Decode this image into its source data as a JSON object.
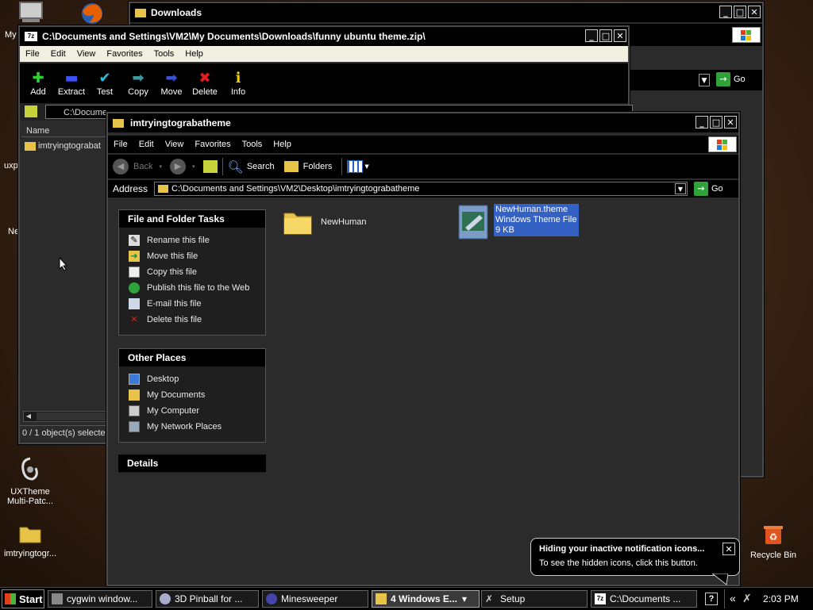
{
  "desktop": {
    "icons": {
      "my_computer": "My",
      "uxp": "uxp",
      "ne": "Ne",
      "uxtheme": "UXTheme Multi-Patc...",
      "folder": "imtryingtogr...",
      "recycle": "Recycle Bin"
    }
  },
  "downloads_window": {
    "title": "Downloads",
    "go_label": "Go"
  },
  "zip_window": {
    "title": "C:\\Documents and Settings\\VM2\\My Documents\\Downloads\\funny ubuntu theme.zip\\",
    "menu": [
      "File",
      "Edit",
      "View",
      "Favorites",
      "Tools",
      "Help"
    ],
    "toolbar": [
      "Add",
      "Extract",
      "Test",
      "Copy",
      "Move",
      "Delete",
      "Info"
    ],
    "path": "C:\\Docume",
    "column_name": "Name",
    "item": "imtryingtograbat",
    "status": "0 / 1 object(s) selecte"
  },
  "explorer": {
    "title": "imtryingtograbatheme",
    "menu": [
      "File",
      "Edit",
      "View",
      "Favorites",
      "Tools",
      "Help"
    ],
    "back_label": "Back",
    "search_label": "Search",
    "folders_label": "Folders",
    "address_label": "Address",
    "address_value": "C:\\Documents and Settings\\VM2\\Desktop\\imtryingtograbatheme",
    "go_label": "Go",
    "file_tasks": {
      "header": "File and Folder Tasks",
      "items": [
        "Rename this file",
        "Move this file",
        "Copy this file",
        "Publish this file to the Web",
        "E-mail this file",
        "Delete this file"
      ]
    },
    "other_places": {
      "header": "Other Places",
      "items": [
        "Desktop",
        "My Documents",
        "My Computer",
        "My Network Places"
      ]
    },
    "details": {
      "header": "Details"
    },
    "files": {
      "folder_name": "NewHuman",
      "theme_name": "NewHuman.theme",
      "theme_type": "Windows Theme File",
      "theme_size": "9 KB"
    }
  },
  "balloon": {
    "title": "Hiding your inactive notification icons...",
    "body": "To see the hidden icons, click this button."
  },
  "taskbar": {
    "start": "Start",
    "items": [
      "cygwin window...",
      "3D Pinball for ...",
      "Minesweeper",
      "4 Windows E...",
      "Setup",
      "C:\\Documents ..."
    ],
    "tray_chevron": "«",
    "clock": "2:03 PM",
    "help": "?"
  }
}
